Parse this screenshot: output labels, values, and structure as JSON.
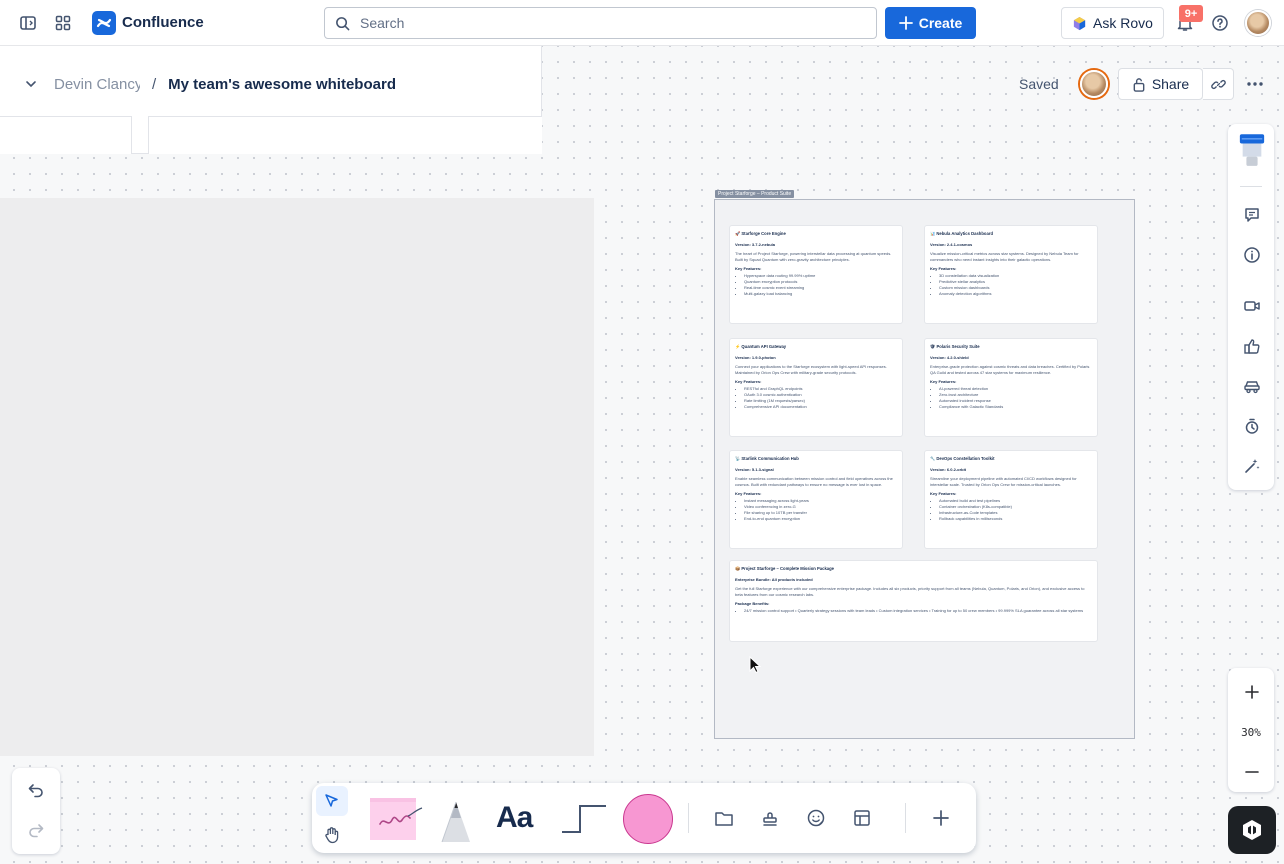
{
  "topbar": {
    "app_name": "Confluence",
    "search_placeholder": "Search",
    "create_label": "Create",
    "ask_rovo_label": "Ask Rovo",
    "notification_count": "9+"
  },
  "header": {
    "space_name": "Devin Clancy",
    "separator": "/",
    "page_title": "My team's awesome whiteboard",
    "saved_label": "Saved",
    "share_label": "Share"
  },
  "canvas": {
    "frame_label": "Project Starforge – Product Suite",
    "cards": [
      {
        "title": "🚀 Starforge Core Engine",
        "version": "Version: 3.7.2-nebula",
        "description": "The heart of Project Starforge, powering interstellar data processing at quantum speeds. Built by Squad Quantum with zero-gravity architecture principles.",
        "features_label": "Key Features:",
        "features": [
          "Hyperspace data routing 99.99% uptime",
          "Quantum encryption protocols",
          "Real-time cosmic event streaming",
          "Multi-galaxy load balancing"
        ]
      },
      {
        "title": "📊 Nebula Analytics Dashboard",
        "version": "Version: 2.4.1-cosmos",
        "description": "Visualize mission-critical metrics across star systems. Designed by Nebula Team for commanders who need instant insights into their galactic operations.",
        "features_label": "Key Features:",
        "features": [
          "3D constellation data visualization",
          "Predictive stellar analytics",
          "Custom mission dashboards",
          "Anomaly detection algorithms"
        ]
      },
      {
        "title": "⚡ Quantum API Gateway",
        "version": "Version: 1.9.0-photon",
        "description": "Connect your applications to the Starforge ecosystem with light-speed API responses. Maintained by Orion Ops Crew with military-grade security protocols.",
        "features_label": "Key Features:",
        "features": [
          "RESTful and GraphQL endpoints",
          "OAuth 3.0 cosmic authentication",
          "Rate limiting (1M requests/parsec)",
          "Comprehensive API documentation"
        ]
      },
      {
        "title": "🛡 Polaris Security Suite",
        "version": "Version: 4.2.0-shield",
        "description": "Enterprise-grade protection against cosmic threats and data breaches. Certified by Polaris QA Guild and tested across 47 star systems for maximum resilience.",
        "features_label": "Key Features:",
        "features": [
          "AI-powered threat detection",
          "Zero-trust architecture",
          "Automated incident response",
          "Compliance with Galactic Standards"
        ]
      },
      {
        "title": "📡 Starlink Communication Hub",
        "version": "Version: 5.1.3-signal",
        "description": "Enable seamless communication between mission control and field operatives across the cosmos. Built with redundant pathways to ensure no message is ever lost in space.",
        "features_label": "Key Features:",
        "features": [
          "Instant messaging across light-years",
          "Video conferencing in zero-G",
          "File sharing up to 10TB per transfer",
          "End-to-end quantum encryption"
        ]
      },
      {
        "title": "🔧 DevOps Constellation Toolkit",
        "version": "Version: 6.0.2-orbit",
        "description": "Streamline your deployment pipeline with automated CI/CD workflows designed for interstellar scale. Trusted by Orion Ops Crew for mission-critical launches.",
        "features_label": "Key Features:",
        "features": [
          "Automated build and test pipelines",
          "Container orchestration (K8s-compatible)",
          "Infrastructure-as-Code templates",
          "Rollback capabilities in milliseconds"
        ]
      }
    ],
    "package": {
      "title": "📦 Project Starforge – Complete Mission Package",
      "bundle": "Enterprise Bundle: All products included",
      "description": "Get the full Starforge experience with our comprehensive enterprise package. Includes all six products, priority support from all teams (Nebula, Quantum, Polaris, and Orion), and exclusive access to beta features from our cosmic research labs.",
      "benefits_label": "Package Benefits:",
      "benefits": [
        "24/7 mission control support • Quarterly strategy sessions with team leads • Custom integration services • Training for up to 50 crew members • 99.999% SLA guarantee across all star systems"
      ]
    }
  },
  "zoom": {
    "level": "30%"
  },
  "toolbar": {
    "text_tool_label": "Aa"
  },
  "colors": {
    "accent": "#1868db",
    "sticky_note": "#fdd0ec",
    "shape_fill": "#f797d2",
    "badge": "#f87168"
  },
  "icons": [
    "sidebar-toggle-icon",
    "app-switcher-icon",
    "confluence-logo-icon",
    "search-icon",
    "plus-icon",
    "rovo-icon",
    "bell-icon",
    "help-icon",
    "chevron-down-icon",
    "lock-icon",
    "link-icon",
    "more-icon",
    "comment-icon",
    "info-icon",
    "video-icon",
    "thumbs-up-icon",
    "car-icon",
    "timer-icon",
    "magic-wand-icon",
    "zoom-in-icon",
    "zoom-out-icon",
    "undo-icon",
    "redo-icon",
    "pointer-icon",
    "hand-icon",
    "sticky-note-icon",
    "pen-icon",
    "connector-icon",
    "frame-icon",
    "stamp-icon",
    "sticker-icon",
    "template-icon",
    "add-icon",
    "ai-assistant-icon"
  ]
}
